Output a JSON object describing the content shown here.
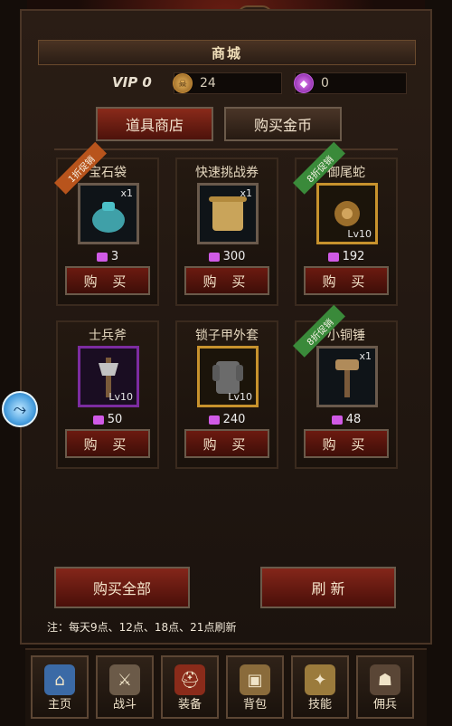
{
  "header": {
    "title": "商城"
  },
  "wallet": {
    "vip_label": "VIP 0",
    "gold_amount": "24",
    "gem_amount": "0"
  },
  "tabs": [
    {
      "label": "道具商店",
      "active": true
    },
    {
      "label": "购买金币",
      "active": false
    }
  ],
  "items": [
    {
      "name": "宝石袋",
      "qty": "x1",
      "level": "",
      "price": "3",
      "promo": "1折促销",
      "promo_color": "#b8541c",
      "border": "default",
      "buy_label": "购 买",
      "icon": "gem-bag-icon"
    },
    {
      "name": "快速挑战券",
      "qty": "x1",
      "level": "",
      "price": "300",
      "promo": "",
      "promo_color": "",
      "border": "default",
      "buy_label": "购 买",
      "icon": "scroll-icon"
    },
    {
      "name": "御尾蛇",
      "qty": "",
      "level": "Lv10",
      "price": "192",
      "promo": "8折促销",
      "promo_color": "#3a8a3a",
      "border": "gold",
      "buy_label": "购 买",
      "icon": "amulet-icon"
    },
    {
      "name": "士兵斧",
      "qty": "",
      "level": "Lv10",
      "price": "50",
      "promo": "",
      "promo_color": "",
      "border": "purple",
      "buy_label": "购 买",
      "icon": "axe-icon"
    },
    {
      "name": "锁子甲外套",
      "qty": "",
      "level": "Lv10",
      "price": "240",
      "promo": "",
      "promo_color": "",
      "border": "gold",
      "buy_label": "购 买",
      "icon": "armor-icon"
    },
    {
      "name": "小铜锤",
      "qty": "x1",
      "level": "",
      "price": "48",
      "promo": "8折促销",
      "promo_color": "#3a8a3a",
      "border": "default",
      "buy_label": "购 买",
      "icon": "hammer-icon"
    }
  ],
  "actions": {
    "buy_all": "购买全部",
    "refresh": "刷 新",
    "note": "注：每天9点、12点、18点、21点刷新"
  },
  "bottom_nav": [
    {
      "label": "主页",
      "icon": "home-icon"
    },
    {
      "label": "战斗",
      "icon": "crossed-swords-icon"
    },
    {
      "label": "装备",
      "icon": "helmet-icon"
    },
    {
      "label": "背包",
      "icon": "backpack-icon"
    },
    {
      "label": "技能",
      "icon": "spellbook-icon"
    },
    {
      "label": "佣兵",
      "icon": "hooded-mercenary-icon"
    }
  ],
  "colors": {
    "gold_currency": "#c58a36",
    "gem_currency": "#c35ee0",
    "promo_orange": "#b8541c",
    "promo_green": "#3a8a3a",
    "buy_button": "#6c1a10",
    "side_orb": "#4aa0e0"
  }
}
